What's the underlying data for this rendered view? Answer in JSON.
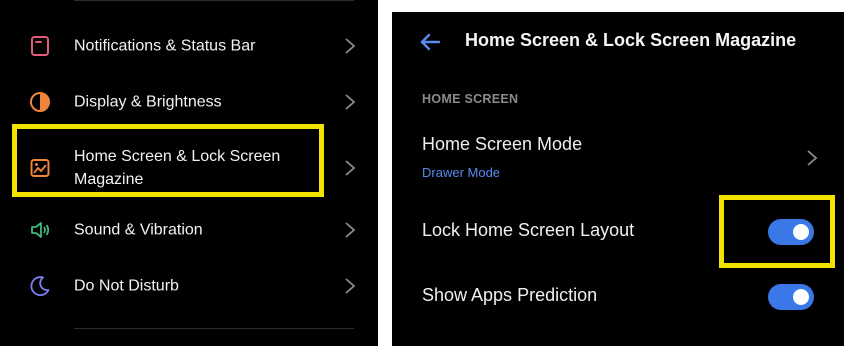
{
  "left_menu": {
    "items": [
      {
        "label": "Notifications & Status Bar",
        "icon": "notification-icon",
        "icon_color": "#e05a7a"
      },
      {
        "label": "Display & Brightness",
        "icon": "brightness-icon",
        "icon_color": "#f0853a"
      },
      {
        "label": "Home Screen & Lock Screen Magazine",
        "icon": "wallpaper-icon",
        "icon_color": "#f0853a"
      },
      {
        "label": "Sound & Vibration",
        "icon": "speaker-icon",
        "icon_color": "#3dbb7a"
      },
      {
        "label": "Do Not Disturb",
        "icon": "moon-icon",
        "icon_color": "#7a7ff0"
      }
    ]
  },
  "detail": {
    "title": "Home Screen & Lock Screen Magazine",
    "section_header": "HOME SCREEN",
    "home_screen_mode": {
      "label": "Home Screen Mode",
      "value": "Drawer Mode"
    },
    "lock_layout": {
      "label": "Lock Home Screen Layout",
      "enabled": true
    },
    "apps_prediction": {
      "label": "Show Apps Prediction",
      "enabled": true
    }
  },
  "colors": {
    "highlight": "#f4e200",
    "toggle_on": "#3b78e7",
    "accent_text": "#5a8bf0"
  }
}
